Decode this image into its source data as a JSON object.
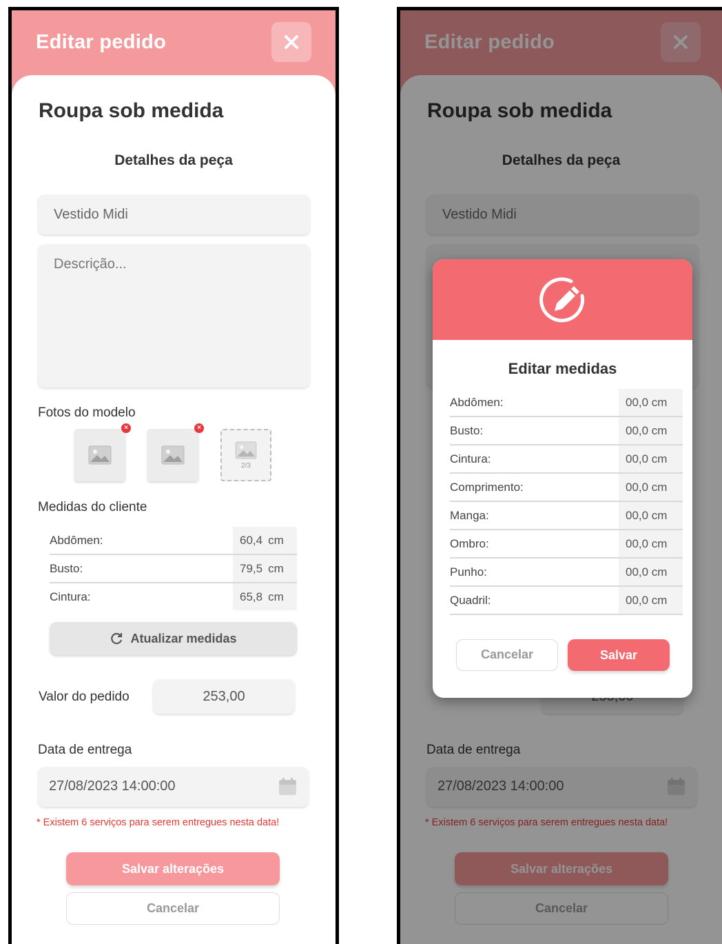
{
  "left": {
    "appbar": {
      "title": "Editar pedido",
      "close_icon": "close-icon"
    },
    "title": "Roupa sob medida",
    "subtitle": "Detalhes da peça",
    "name_value": "Vestido Midi",
    "description_placeholder": "Descrição...",
    "photos": {
      "label": "Fotos do modelo",
      "counter": "2/3",
      "items": [
        "image-icon",
        "image-icon"
      ]
    },
    "measurements": {
      "label": "Medidas do cliente",
      "rows": [
        {
          "label": "Abdômen:",
          "value": "60,4",
          "unit": "cm"
        },
        {
          "label": "Busto:",
          "value": "79,5",
          "unit": "cm"
        },
        {
          "label": "Cintura:",
          "value": "65,8",
          "unit": "cm"
        }
      ],
      "update_button": "Atualizar medidas"
    },
    "order_value": {
      "label": "Valor do pedido",
      "value": "253,00"
    },
    "delivery": {
      "label": "Data de entrega",
      "value": "27/08/2023 14:00:00",
      "warning": "* Existem 6 serviços para serem entregues nesta data!"
    },
    "buttons": {
      "save": "Salvar alterações",
      "cancel": "Cancelar"
    }
  },
  "right": {
    "background": {
      "appbar_title": "Editar pedido",
      "title": "Roupa sob medida",
      "subtitle": "Detalhes da peça",
      "name_value": "Vestido Midi",
      "order_value": "253,00",
      "delivery_label": "Data de entrega",
      "delivery_value": "27/08/2023 14:00:00",
      "warning": "* Existem 6 serviços para serem entregues nesta data!",
      "save": "Salvar alterações",
      "cancel": "Cancelar"
    },
    "modal": {
      "icon": "edit-pencil-icon",
      "title": "Editar medidas",
      "rows": [
        {
          "label": "Abdômen:",
          "value": "00,0 cm"
        },
        {
          "label": "Busto:",
          "value": "00,0 cm"
        },
        {
          "label": "Cintura:",
          "value": "00,0 cm"
        },
        {
          "label": "Comprimento:",
          "value": "00,0 cm"
        },
        {
          "label": "Manga:",
          "value": "00,0 cm"
        },
        {
          "label": "Ombro:",
          "value": "00,0 cm"
        },
        {
          "label": "Punho:",
          "value": "00,0 cm"
        },
        {
          "label": "Quadril:",
          "value": "00,0 cm"
        }
      ],
      "cancel": "Cancelar",
      "save": "Salvar"
    }
  },
  "colors": {
    "appbar": "#f49a9d",
    "accent": "#f36b70",
    "warning": "#e53935"
  }
}
